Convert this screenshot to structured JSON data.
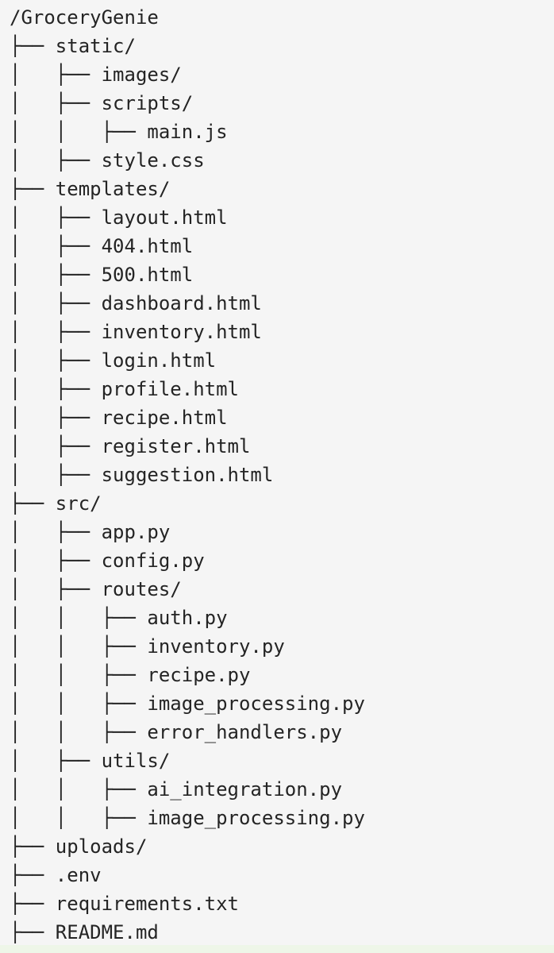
{
  "tree": {
    "lines": [
      "/GroceryGenie",
      "├── static/",
      "│   ├── images/",
      "│   ├── scripts/",
      "│   │   ├── main.js",
      "│   ├── style.css",
      "├── templates/",
      "│   ├── layout.html",
      "│   ├── 404.html",
      "│   ├── 500.html",
      "│   ├── dashboard.html",
      "│   ├── inventory.html",
      "│   ├── login.html",
      "│   ├── profile.html",
      "│   ├── recipe.html",
      "│   ├── register.html",
      "│   ├── suggestion.html",
      "├── src/",
      "│   ├── app.py",
      "│   ├── config.py",
      "│   ├── routes/",
      "│   │   ├── auth.py",
      "│   │   ├── inventory.py",
      "│   │   ├── recipe.py",
      "│   │   ├── image_processing.py",
      "│   │   ├── error_handlers.py",
      "│   ├── utils/",
      "│   │   ├── ai_integration.py",
      "│   │   ├── image_processing.py",
      "├── uploads/",
      "├── .env",
      "├── requirements.txt",
      "├── README.md"
    ]
  }
}
